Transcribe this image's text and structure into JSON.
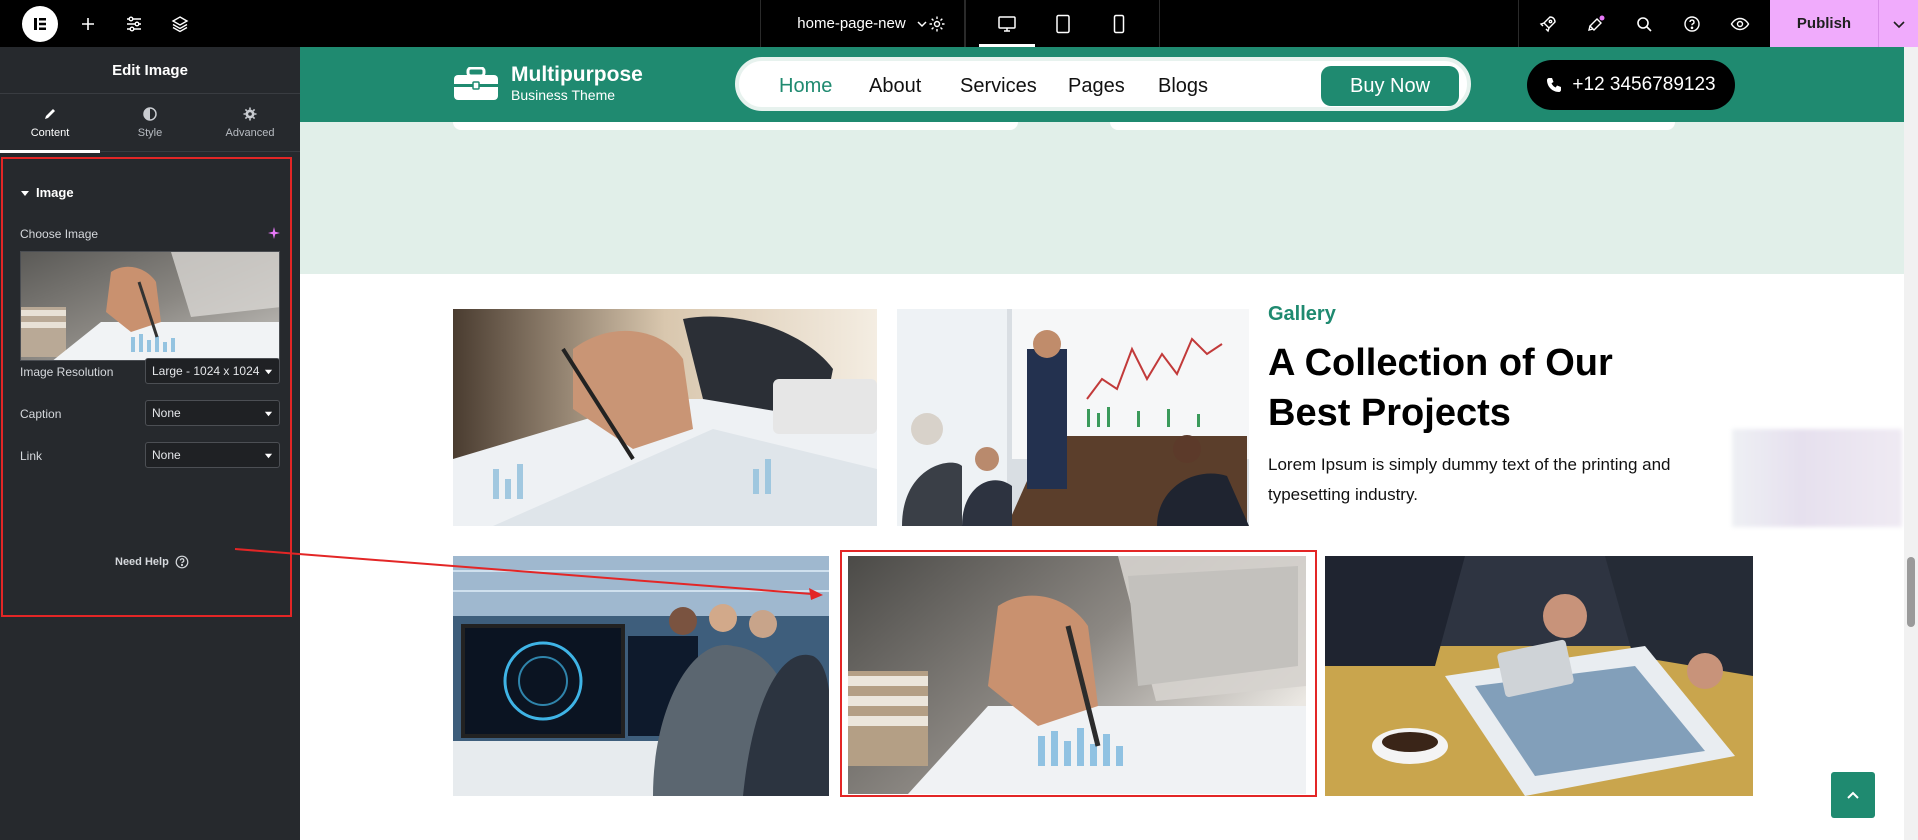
{
  "topbar": {
    "document_name": "home-page-new",
    "publish_label": "Publish",
    "icons": [
      "elementor-logo-icon",
      "add-icon",
      "settings-sliders-icon",
      "layers-icon",
      "chevron-down-icon",
      "gear-icon",
      "desktop-icon",
      "tablet-icon",
      "mobile-icon",
      "rocket-icon",
      "notifications-icon",
      "search-icon",
      "help-icon",
      "preview-eye-icon"
    ]
  },
  "panel": {
    "title": "Edit Image",
    "tabs": [
      {
        "label": "Content",
        "icon": "pencil-icon",
        "active": true
      },
      {
        "label": "Style",
        "icon": "half-circle-icon",
        "active": false
      },
      {
        "label": "Advanced",
        "icon": "gear-icon",
        "active": false
      }
    ],
    "section_title": "Image",
    "choose_image_label": "Choose Image",
    "controls": [
      {
        "label": "Image Resolution",
        "value": "Large - 1024 x 1024"
      },
      {
        "label": "Caption",
        "value": "None"
      },
      {
        "label": "Link",
        "value": "None"
      }
    ],
    "need_help": "Need Help"
  },
  "site": {
    "brand_name": "Multipurpose",
    "brand_tagline": "Business Theme",
    "nav": [
      {
        "label": "Home",
        "active": true
      },
      {
        "label": "About",
        "active": false
      },
      {
        "label": "Services",
        "active": false
      },
      {
        "label": "Pages",
        "active": false
      },
      {
        "label": "Blogs",
        "active": false
      }
    ],
    "buy_label": "Buy Now",
    "phone": "+12 3456789123",
    "colors": {
      "primary": "#1f8a70",
      "mint": "#e1efe9",
      "accent_red": "#e32626",
      "publish": "#f0abfc"
    }
  },
  "gallery": {
    "subtitle": "Gallery",
    "title": "A Collection of Our Best Projects",
    "description": "Lorem Ipsum is simply dummy text of the printing and typesetting industry."
  }
}
